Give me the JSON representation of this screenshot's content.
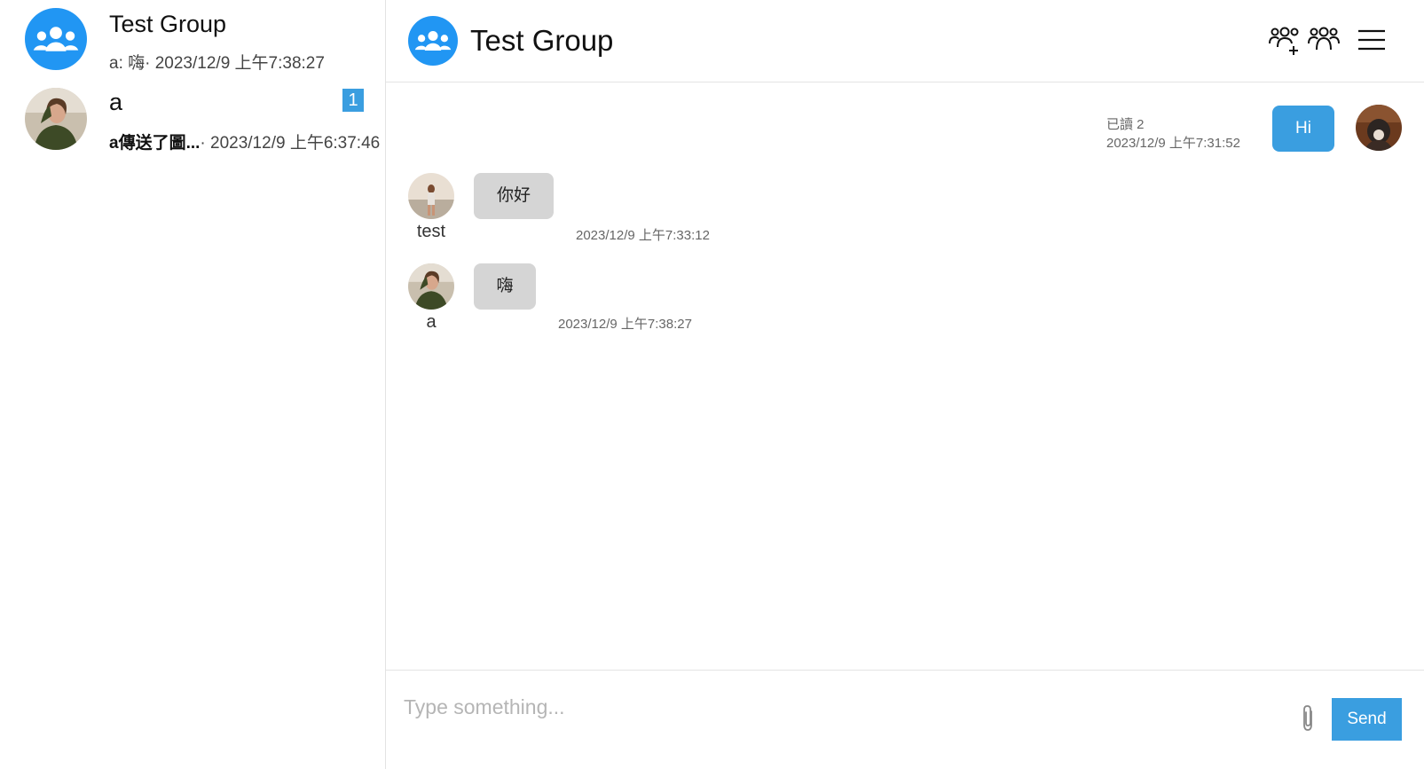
{
  "sidebar": {
    "conversations": [
      {
        "name": "Test Group",
        "preview": "a: 嗨· 2023/12/9 上午7:38:27",
        "avatar": "group-icon"
      },
      {
        "name": "a",
        "preview_bold": "a傳送了圖...",
        "preview_rest": "· 2023/12/9 上午6:37:46",
        "unread": "1",
        "avatar": "user-photo"
      }
    ]
  },
  "header": {
    "title": "Test Group",
    "icons": [
      "group-icon",
      "add-member-icon",
      "members-icon",
      "menu-icon"
    ]
  },
  "messages": [
    {
      "direction": "out",
      "text": "Hi",
      "read": "已讀 2",
      "time": "2023/12/9 上午7:31:52"
    },
    {
      "direction": "in",
      "sender": "test",
      "text": "你好",
      "time": "2023/12/9 上午7:33:12"
    },
    {
      "direction": "in",
      "sender": "a",
      "text": "嗨",
      "time": "2023/12/9 上午7:38:27"
    }
  ],
  "composer": {
    "placeholder": "Type something...",
    "send_label": "Send",
    "attach_icon": "paperclip-icon"
  },
  "colors": {
    "accent": "#3a9ee0",
    "group_avatar": "#2196f3",
    "incoming_bubble": "#d5d5d5"
  }
}
